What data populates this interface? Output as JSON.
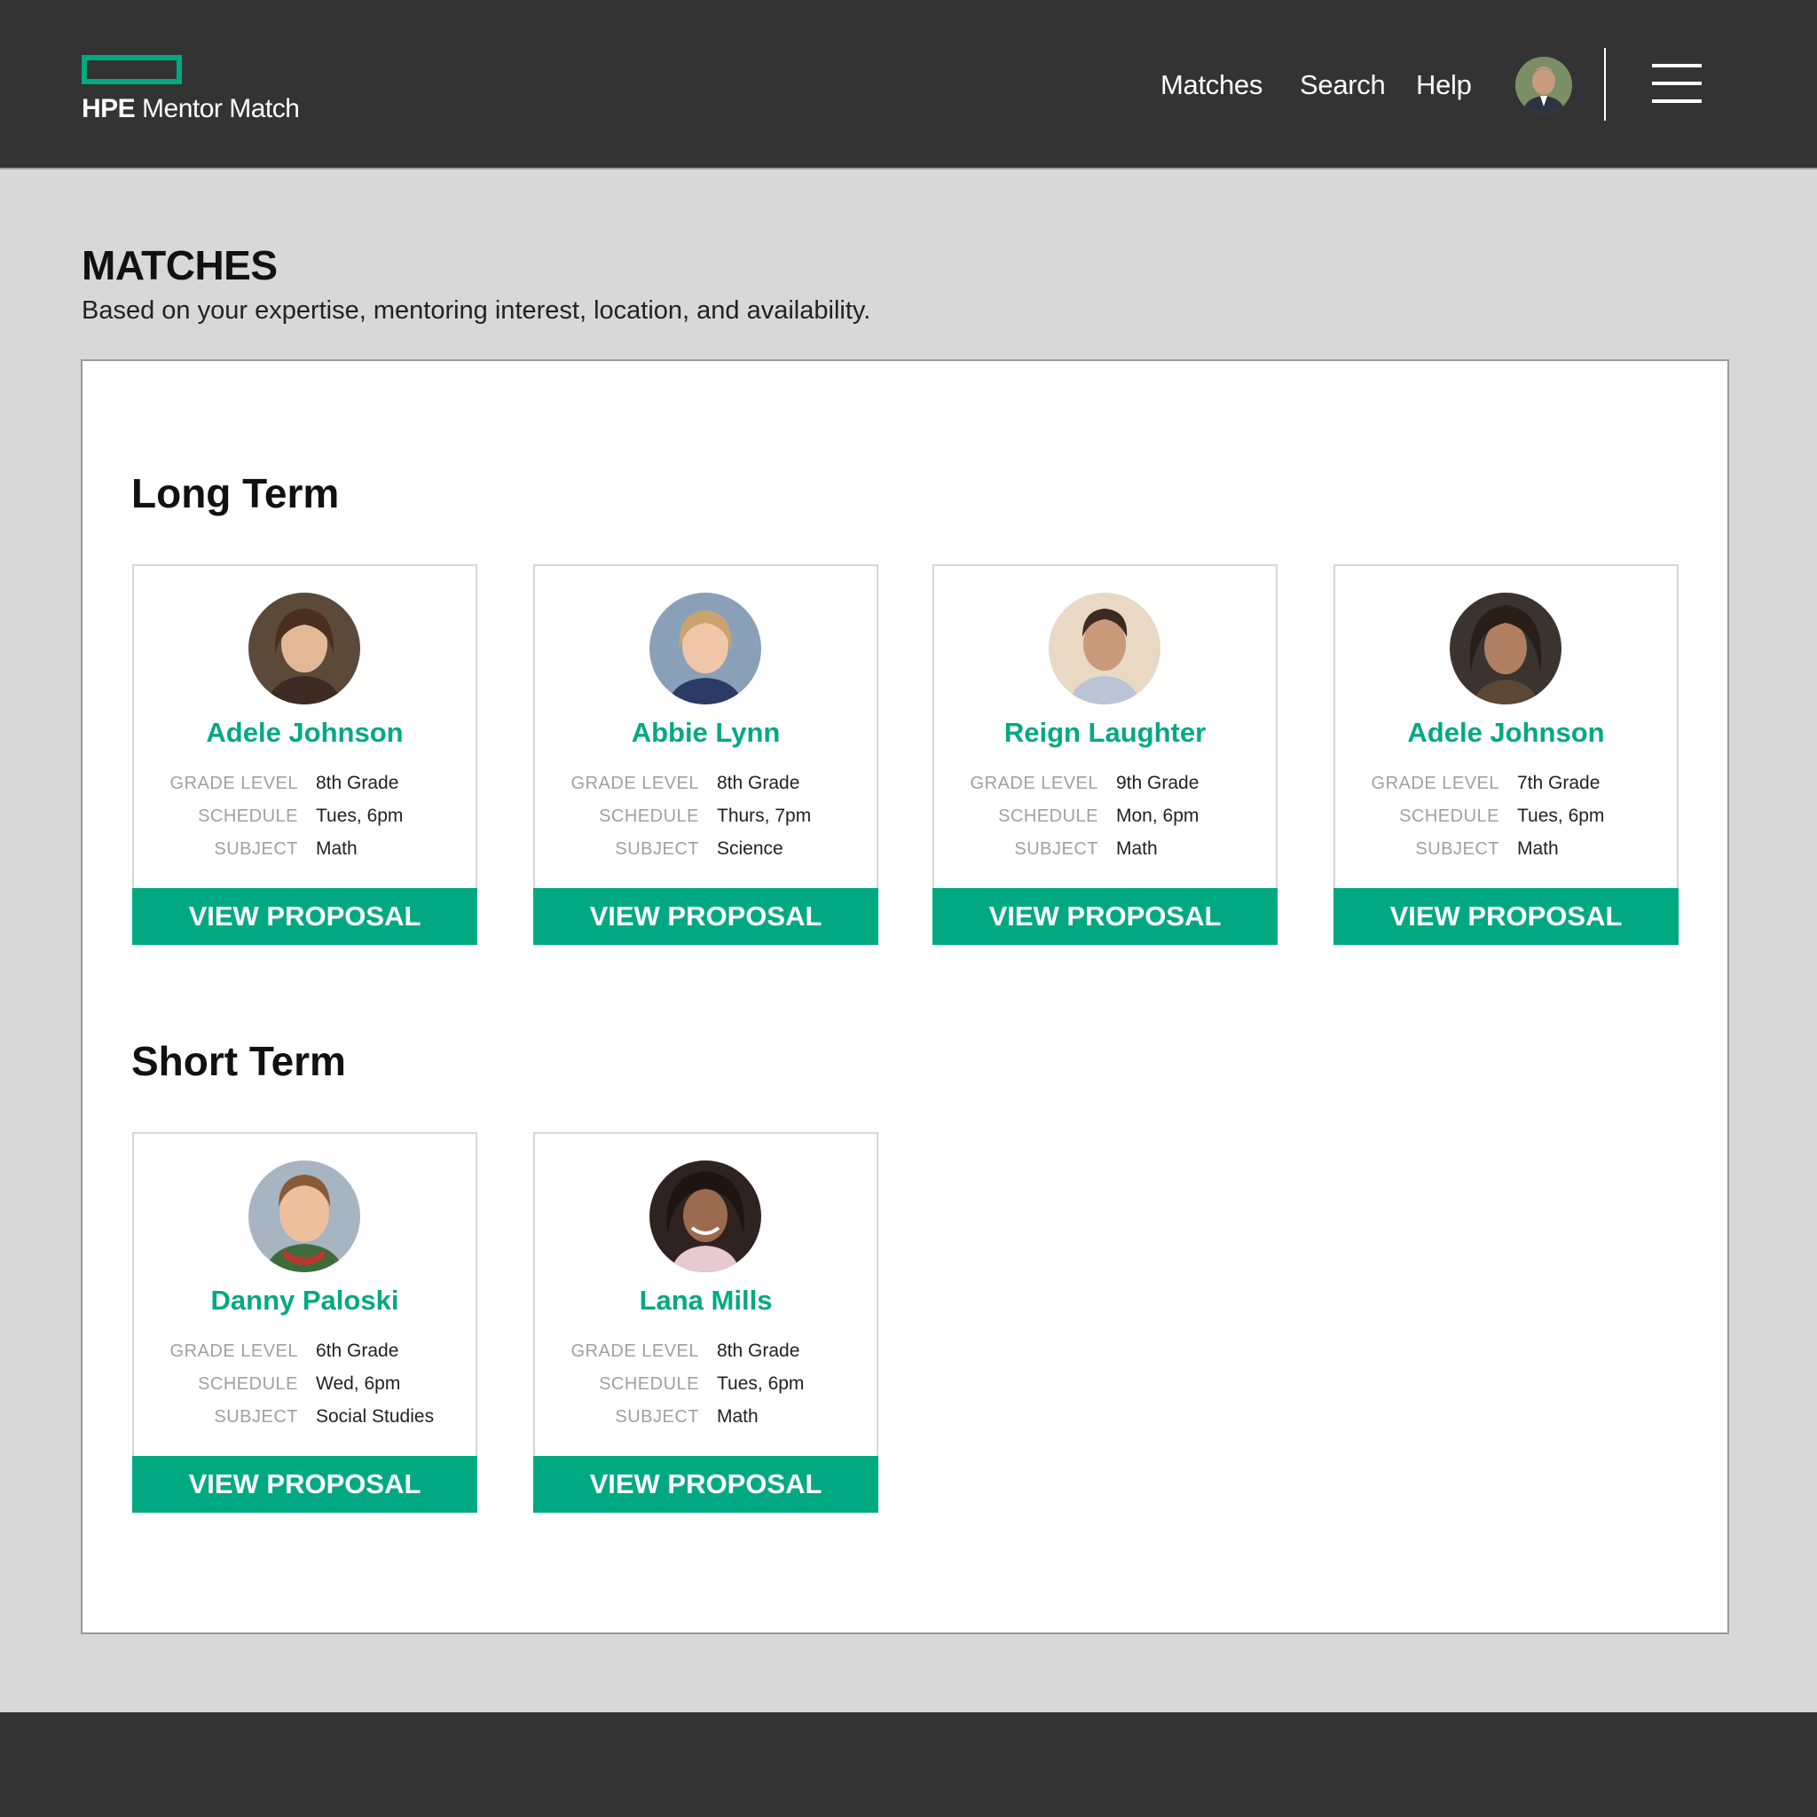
{
  "header": {
    "logo_brand": "HPE",
    "logo_product": "Mentor Match",
    "nav": [
      "Matches",
      "Search",
      "Help"
    ]
  },
  "page": {
    "title": "MATCHES",
    "subtitle": "Based on your expertise, mentoring interest, location, and availability."
  },
  "labels": {
    "grade": "GRADE LEVEL",
    "schedule": "SCHEDULE",
    "subject": "SUBJECT",
    "button": "VIEW PROPOSAL"
  },
  "sections": [
    {
      "title": "Long Term",
      "cards": [
        {
          "name": "Adele Johnson",
          "grade": "8th Grade",
          "schedule": "Tues, 6pm",
          "subject": "Math"
        },
        {
          "name": "Abbie Lynn",
          "grade": "8th Grade",
          "schedule": "Thurs, 7pm",
          "subject": "Science"
        },
        {
          "name": "Reign Laughter",
          "grade": "9th Grade",
          "schedule": "Mon, 6pm",
          "subject": "Math"
        },
        {
          "name": "Adele Johnson",
          "grade": "7th Grade",
          "schedule": "Tues, 6pm",
          "subject": "Math"
        }
      ]
    },
    {
      "title": "Short Term",
      "cards": [
        {
          "name": "Danny Paloski",
          "grade": "6th Grade",
          "schedule": "Wed, 6pm",
          "subject": "Social Studies"
        },
        {
          "name": "Lana Mills",
          "grade": "8th Grade",
          "schedule": "Tues, 6pm",
          "subject": "Math"
        }
      ]
    }
  ],
  "colors": {
    "accent": "#01a982",
    "topbar": "#333333",
    "background": "#d8d8d8"
  }
}
